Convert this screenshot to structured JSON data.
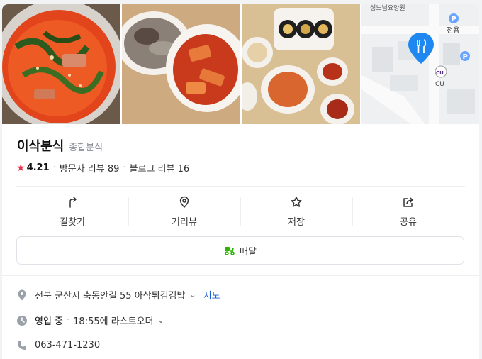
{
  "place": {
    "name": "이삭분식",
    "category": "종합분식",
    "rating": "4.21",
    "visitor_reviews": "방문자 리뷰 89",
    "blog_reviews": "블로그 리뷰 16"
  },
  "photos": [
    {
      "icon": "food-photo-ramen"
    },
    {
      "icon": "food-photo-sundae-tteokbokki"
    },
    {
      "icon": "food-photo-kimbap-platter"
    },
    {
      "icon": "map-thumbnail",
      "map_labels": [
        "성느님요양원",
        "전용",
        "CU"
      ]
    }
  ],
  "actions": [
    {
      "label": "길찾기",
      "icon": "directions-icon"
    },
    {
      "label": "거리뷰",
      "icon": "street-view-icon"
    },
    {
      "label": "저장",
      "icon": "star-outline-icon"
    },
    {
      "label": "공유",
      "icon": "share-icon"
    }
  ],
  "delivery": {
    "label": "배달",
    "icon": "delivery-scooter-icon",
    "color": "#2db400"
  },
  "info": {
    "address": "전북 군산시 축동안길 55 아삭튀김김밥",
    "map_link": "지도",
    "status": "영업 중",
    "hours": "18:55에 라스트오더",
    "phone": "063-471-1230"
  },
  "colors": {
    "accent": "#1a5fd1",
    "star": "#e8344e",
    "map_pin": "#1e88f0"
  }
}
